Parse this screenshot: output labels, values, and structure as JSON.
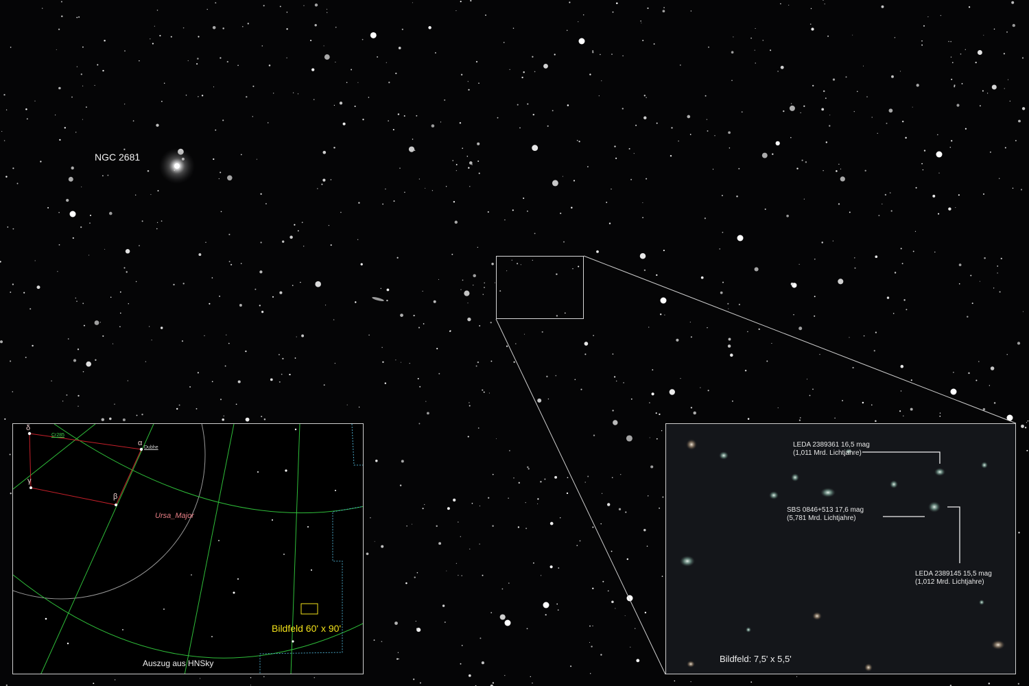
{
  "main_image": {
    "galaxy_label": "NGC 2681"
  },
  "chart_inset": {
    "stars": {
      "delta": "δ",
      "alpha": "α",
      "gamma": "γ",
      "beta": "β"
    },
    "cluster_label": "Cr285",
    "star_name": "Dubhe",
    "constellation": "Ursa_Major",
    "field_label": "Bildfeld  60' x 90'",
    "credit": "Auszug aus HNSky"
  },
  "zoom_inset": {
    "objects": [
      {
        "name": "LEDA 2389361   16,5 mag",
        "distance": "(1,011 Mrd. Lichtjahre)"
      },
      {
        "name": "SBS 0846+513   17,6 mag",
        "distance": "(5,781 Mrd. Lichtjahre)"
      },
      {
        "name": "LEDA 2389145   15,5 mag",
        "distance": "(1,012 Mrd. Lichtjahre)"
      }
    ],
    "field_label": "Bildfeld:  7,5' x 5,5'"
  },
  "colors": {
    "sky": "#050506",
    "grid_lines": "#2fbf3a",
    "constellation_lines": "#c8202a",
    "field_marker": "#f3e21a",
    "boundary": "#4aa8c8"
  }
}
